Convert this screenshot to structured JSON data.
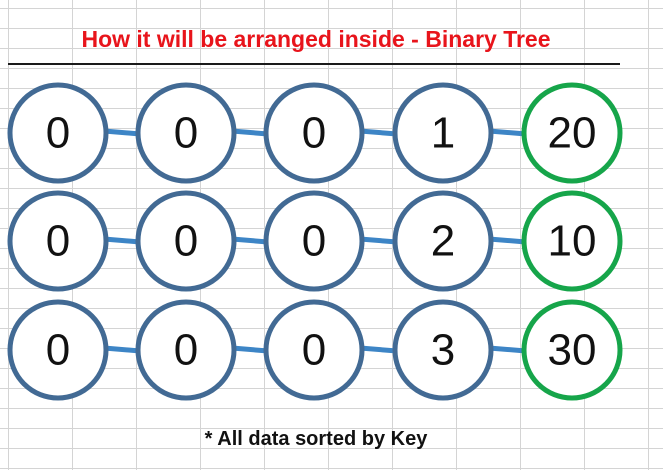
{
  "title": "How it will be arranged inside - Binary Tree",
  "footnote": "* All data sorted by Key",
  "colors": {
    "title": "#e8141b",
    "node_stroke": "#426a94",
    "key_node_stroke": "#16a54a",
    "connector": "#3d85c6",
    "node_fill": "#ffffff"
  },
  "rows": [
    {
      "nodes": [
        "0",
        "0",
        "0",
        "1",
        "20"
      ]
    },
    {
      "nodes": [
        "0",
        "0",
        "0",
        "2",
        "10"
      ]
    },
    {
      "nodes": [
        "0",
        "0",
        "0",
        "3",
        "30"
      ]
    }
  ]
}
